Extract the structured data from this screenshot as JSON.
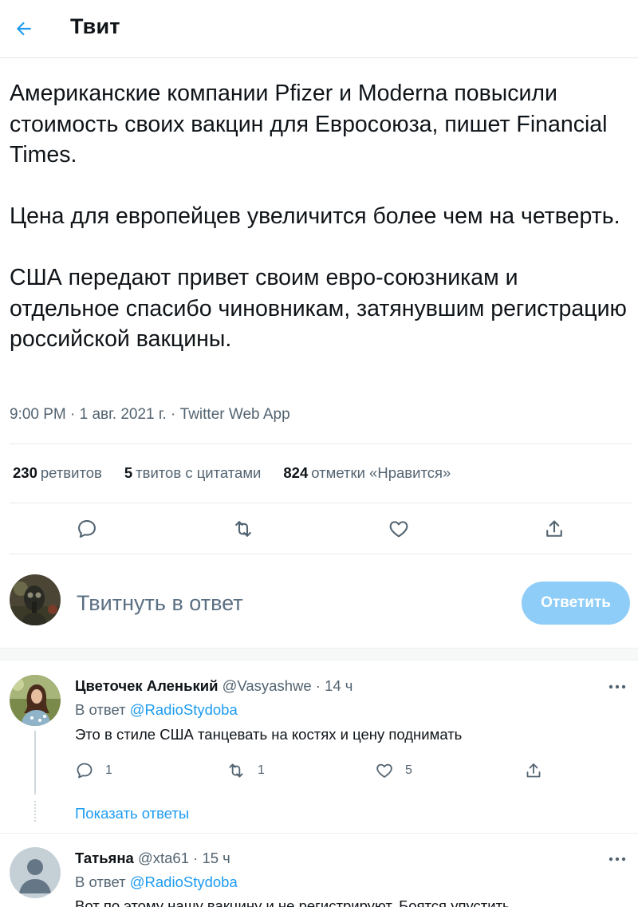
{
  "header": {
    "title": "Твит"
  },
  "tweet": {
    "paragraphs": [
      "Американские компании Pfizer и Moderna повысили стоимость своих вакцин для Евросоюза, пишет Financial Times.",
      "Цена для европейцев увеличится более чем на четверть.",
      "США передают привет своим евро-союзникам и отдельное спасибо чиновникам, затянувшим регистрацию российской вакцины."
    ],
    "meta": "9:00 PM · 1 авг. 2021 г. · Twitter Web App",
    "stats": {
      "retweets_count": "230",
      "retweets_label": "ретвитов",
      "quotes_count": "5",
      "quotes_label": "твитов с цитатами",
      "likes_count": "824",
      "likes_label": "отметки «Нравится»"
    }
  },
  "compose": {
    "placeholder": "Твитнуть в ответ",
    "button_label": "Ответить"
  },
  "replies": [
    {
      "name": "Цветочек Аленький",
      "handle": "@Vasyashwe",
      "time": "· 14 ч",
      "reply_to_label": "В ответ",
      "reply_to_handle": "@RadioStydoba",
      "text": "Это в стиле США танцевать на костях и цену поднимать",
      "reply_count": "1",
      "retweet_count": "1",
      "like_count": "5",
      "show_replies": "Показать ответы"
    },
    {
      "name": "Татьяна",
      "handle": "@xta61",
      "time": "· 15 ч",
      "reply_to_label": "В ответ",
      "reply_to_handle": "@RadioStydoba",
      "text": "Вот по этому нашу вакцину и не регистрируют. Боятся упустить"
    }
  ],
  "colors": {
    "accent": "#1d9bf0",
    "button_disabled": "#8ecdf7",
    "secondary_text": "#536471"
  }
}
